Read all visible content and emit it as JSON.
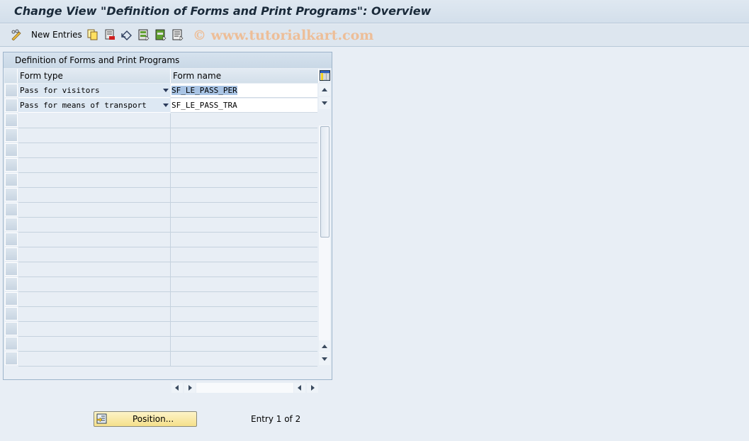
{
  "window": {
    "title": "Change View \"Definition of Forms and Print Programs\": Overview"
  },
  "toolbar": {
    "new_entries_label": "New Entries",
    "icons": [
      "edit-glasses-icon",
      "copy-icon",
      "delete-icon",
      "undo-icon",
      "select-all-icon",
      "select-block-icon",
      "deselect-all-icon"
    ],
    "watermark": "© www.tutorialkart.com"
  },
  "table": {
    "title": "Definition of Forms and Print Programs",
    "columns": [
      "Form type",
      "Form name"
    ],
    "rows": [
      {
        "form_type": "Pass for visitors",
        "form_name": "SF_LE_PASS_PER"
      },
      {
        "form_type": "Pass for means of transport",
        "form_name": "SF_LE_PASS_TRA"
      }
    ]
  },
  "footer": {
    "position_label": "Position...",
    "entry_text": "Entry 1 of 2"
  }
}
